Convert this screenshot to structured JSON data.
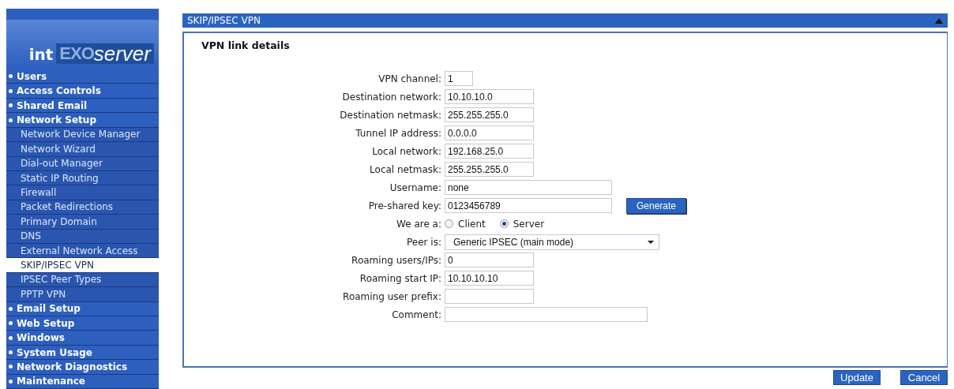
{
  "logo": {
    "brand": "int",
    "product_a": "EXO",
    "product_b": "server"
  },
  "sidebar": {
    "items": [
      {
        "label": "Users",
        "selected": false
      },
      {
        "label": "Access Controls",
        "selected": false
      },
      {
        "label": "Shared Email",
        "selected": false
      },
      {
        "label": "Network Setup",
        "selected": false,
        "children": [
          {
            "label": "Network Device Manager",
            "selected": false
          },
          {
            "label": "Network Wizard",
            "selected": false
          },
          {
            "label": "Dial-out Manager",
            "selected": false
          },
          {
            "label": "Static IP Routing",
            "selected": false
          },
          {
            "label": "Firewall",
            "selected": false
          },
          {
            "label": "Packet Redirections",
            "selected": false
          },
          {
            "label": "Primary Domain",
            "selected": false
          },
          {
            "label": "DNS",
            "selected": false
          },
          {
            "label": "External Network Access",
            "selected": false
          },
          {
            "label": "SKIP/IPSEC VPN",
            "selected": true
          },
          {
            "label": "IPSEC Peer Types",
            "selected": false
          },
          {
            "label": "PPTP VPN",
            "selected": false
          }
        ]
      },
      {
        "label": "Email Setup",
        "selected": false
      },
      {
        "label": "Web Setup",
        "selected": false
      },
      {
        "label": "Windows",
        "selected": false
      },
      {
        "label": "System Usage",
        "selected": false
      },
      {
        "label": "Network Diagnostics",
        "selected": false
      },
      {
        "label": "Maintenance",
        "selected": false
      }
    ]
  },
  "panel": {
    "title": "SKIP/IPSEC VPN",
    "expanded": true,
    "heading": "VPN link details",
    "fields": [
      {
        "kind": "text",
        "label": "VPN channel:",
        "value": "1"
      },
      {
        "kind": "text",
        "label": "Destination network:",
        "value": "10.10.10.0"
      },
      {
        "kind": "text",
        "label": "Destination netmask:",
        "value": "255.255.255.0"
      },
      {
        "kind": "text",
        "label": "Tunnel IP address:",
        "value": "0.0.0.0"
      },
      {
        "kind": "text",
        "label": "Local network:",
        "value": "192.168.25.0"
      },
      {
        "kind": "text",
        "label": "Local netmask:",
        "value": "255.255.255.0"
      },
      {
        "kind": "text",
        "label": "Username:",
        "value": "none"
      },
      {
        "kind": "text",
        "label": "Pre-shared key:",
        "value": "0123456789",
        "button": "Generate"
      },
      {
        "kind": "radio",
        "label": "We are a:",
        "options": [
          {
            "label": "Client",
            "selected": false
          },
          {
            "label": "Server",
            "selected": true
          }
        ]
      },
      {
        "kind": "select",
        "label": "Peer is:",
        "value": "Generic IPSEC (main mode)"
      },
      {
        "kind": "text",
        "label": "Roaming users/IPs:",
        "value": "0"
      },
      {
        "kind": "text",
        "label": "Roaming start IP:",
        "value": "10.10.10.10"
      },
      {
        "kind": "text",
        "label": "Roaming user prefix:"
      },
      {
        "kind": "text",
        "label": "Comment:"
      }
    ]
  },
  "buttons": [
    "Update",
    "Cancel"
  ]
}
